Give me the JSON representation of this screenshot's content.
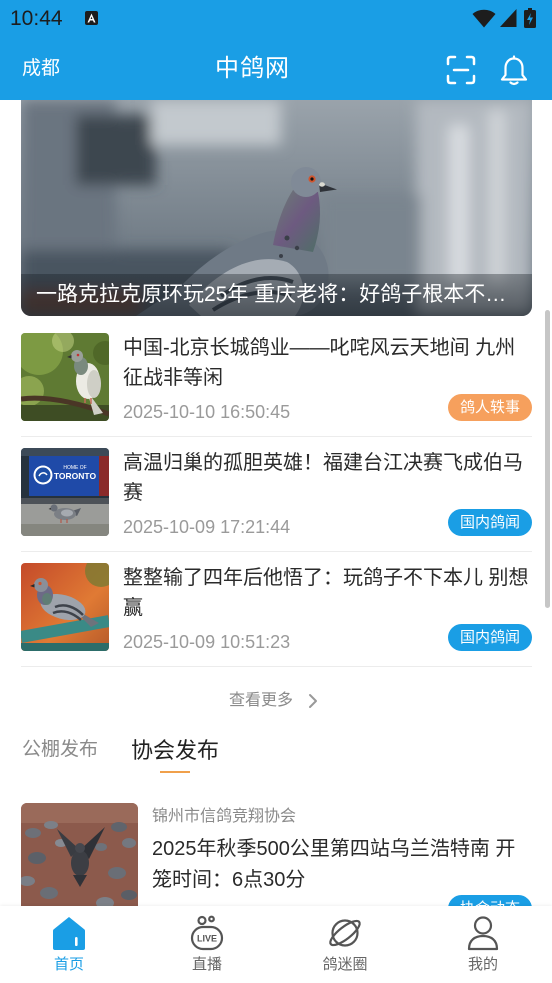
{
  "status_bar": {
    "time": "10:44",
    "icons": [
      "notification-icon",
      "wifi-icon",
      "signal-icon",
      "battery-icon"
    ]
  },
  "header": {
    "location": "成都",
    "title": "中鸽网",
    "icons": [
      "scan-icon",
      "bell-icon"
    ]
  },
  "banner": {
    "caption": "一路克拉克原环玩25年 重庆老将：好鸽子根本不…"
  },
  "news": [
    {
      "title": "中国-北京长城鸽业——叱咤风云天地间 九州征战非等闲",
      "date": "2025-10-10 16:50:45",
      "tag": "鸽人轶事",
      "tag_color": "#f6a05d"
    },
    {
      "title": "高温归巢的孤胆英雄！福建台江决赛飞成伯马赛",
      "date": "2025-10-09 17:21:44",
      "tag": "国内鸽闻",
      "tag_color": "#1a9ee5"
    },
    {
      "title": "整整输了四年后他悟了：玩鸽子不下本儿 别想赢",
      "date": "2025-10-09 10:51:23",
      "tag": "国内鸽闻",
      "tag_color": "#1a9ee5"
    }
  ],
  "thumbnail_text": {
    "home_of": "HOME OF",
    "city": "TORONTO"
  },
  "more": {
    "label": "查看更多",
    "icon": "chevron-right-icon"
  },
  "tabs": [
    {
      "label": "公棚发布",
      "active": false
    },
    {
      "label": "协会发布",
      "active": true
    }
  ],
  "association_posts": [
    {
      "org": "锦州市信鸽竞翔协会",
      "title": "2025年秋季500公里第四站乌兰浩特南 开笼时间：6点30分",
      "tag": "协会动态",
      "tag_color": "#1a9ee5"
    }
  ],
  "bottom_nav": [
    {
      "label": "首页",
      "icon": "home-icon",
      "active": true
    },
    {
      "label": "直播",
      "icon": "live-icon",
      "icon_text": "LIVE",
      "active": false
    },
    {
      "label": "鸽迷圈",
      "icon": "planet-icon",
      "active": false
    },
    {
      "label": "我的",
      "icon": "user-icon",
      "active": false
    }
  ],
  "colors": {
    "primary": "#1a9ee5",
    "tag_orange": "#f6a05d",
    "tab_underline": "#f0a04b",
    "nav_inactive": "#666666"
  }
}
